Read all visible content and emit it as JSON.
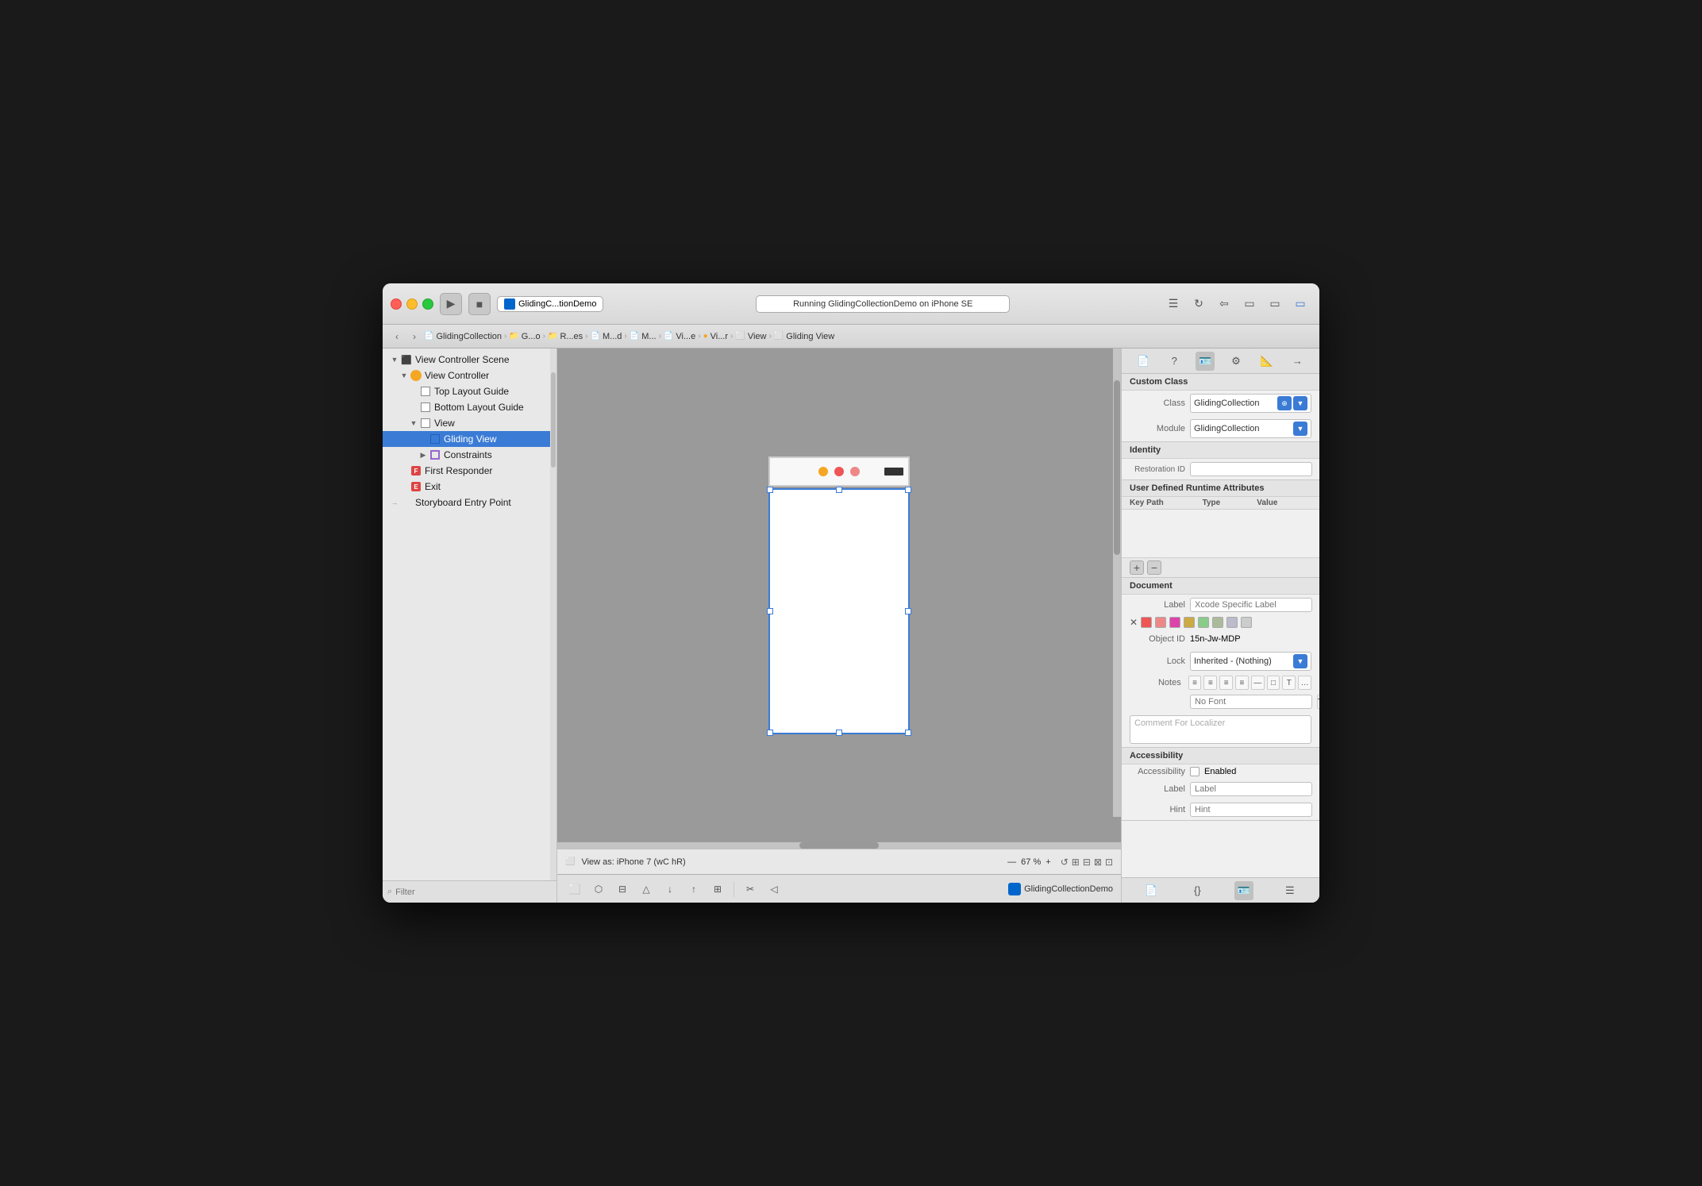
{
  "titlebar": {
    "scheme_name": "GlidingC...tionDemo",
    "run_status": "Running GlidingCollectionDemo on iPhone SE",
    "traffic_lights": [
      "red",
      "yellow",
      "green"
    ]
  },
  "breadcrumb": {
    "items": [
      {
        "label": "GlidingCollection",
        "icon": "file"
      },
      {
        "label": "G...o",
        "icon": "folder-yellow"
      },
      {
        "label": "R...es",
        "icon": "folder-yellow"
      },
      {
        "label": "M...d",
        "icon": "file"
      },
      {
        "label": "M...",
        "icon": "file"
      },
      {
        "label": "Vi...e",
        "icon": "file"
      },
      {
        "label": "Vi...r",
        "icon": "vc"
      },
      {
        "label": "View",
        "icon": "view"
      },
      {
        "label": "Gliding View",
        "icon": "view"
      }
    ]
  },
  "tree": {
    "items": [
      {
        "label": "View Controller Scene",
        "indent": 0,
        "type": "scene",
        "expanded": true
      },
      {
        "label": "View Controller",
        "indent": 1,
        "type": "vc",
        "expanded": true,
        "selected": false
      },
      {
        "label": "Top Layout Guide",
        "indent": 2,
        "type": "layout",
        "expanded": false
      },
      {
        "label": "Bottom Layout Guide",
        "indent": 2,
        "type": "layout",
        "expanded": false
      },
      {
        "label": "View",
        "indent": 2,
        "type": "view",
        "expanded": true
      },
      {
        "label": "Gliding View",
        "indent": 3,
        "type": "gliding",
        "selected": true
      },
      {
        "label": "Constraints",
        "indent": 3,
        "type": "constraints",
        "expanded": false
      },
      {
        "label": "First Responder",
        "indent": 1,
        "type": "responder"
      },
      {
        "label": "Exit",
        "indent": 1,
        "type": "exit"
      },
      {
        "label": "Storyboard Entry Point",
        "indent": 0,
        "type": "entry"
      }
    ],
    "filter_placeholder": "Filter"
  },
  "canvas": {
    "view_as_label": "View as: iPhone 7 (wC hR)",
    "zoom_level": "67 %",
    "zoom_minus": "—",
    "zoom_plus": "+",
    "app_name": "GlidingCollectionDemo"
  },
  "inspector": {
    "title": "Custom Class",
    "class_label": "Class",
    "class_value": "GlidingCollection",
    "module_label": "Module",
    "module_value": "GlidingCollection",
    "identity_title": "Identity",
    "restoration_id_label": "Restoration ID",
    "restoration_id_value": "",
    "udra_title": "User Defined Runtime Attributes",
    "udra_columns": [
      "Key Path",
      "Type",
      "Value"
    ],
    "document_title": "Document",
    "label_label": "Label",
    "label_placeholder": "Xcode Specific Label",
    "object_id_label": "Object ID",
    "object_id_value": "15n-Jw-MDP",
    "lock_label": "Lock",
    "lock_value": "Inherited - (Nothing)",
    "notes_label": "Notes",
    "font_placeholder": "No Font",
    "comment_placeholder": "Comment For Localizer",
    "accessibility_title": "Accessibility",
    "accessibility_label": "Accessibility",
    "enabled_label": "Enabled",
    "label_acc_label": "Label",
    "label_acc_placeholder": "Label",
    "hint_label": "Hint",
    "hint_placeholder": "Hint",
    "color_swatches": [
      "#e55",
      "#e88",
      "#d4a",
      "#ccaa44",
      "#88cc88",
      "#aabb99",
      "#bbbbcc",
      "#cccccc"
    ],
    "add_btn": "+",
    "remove_btn": "−"
  }
}
